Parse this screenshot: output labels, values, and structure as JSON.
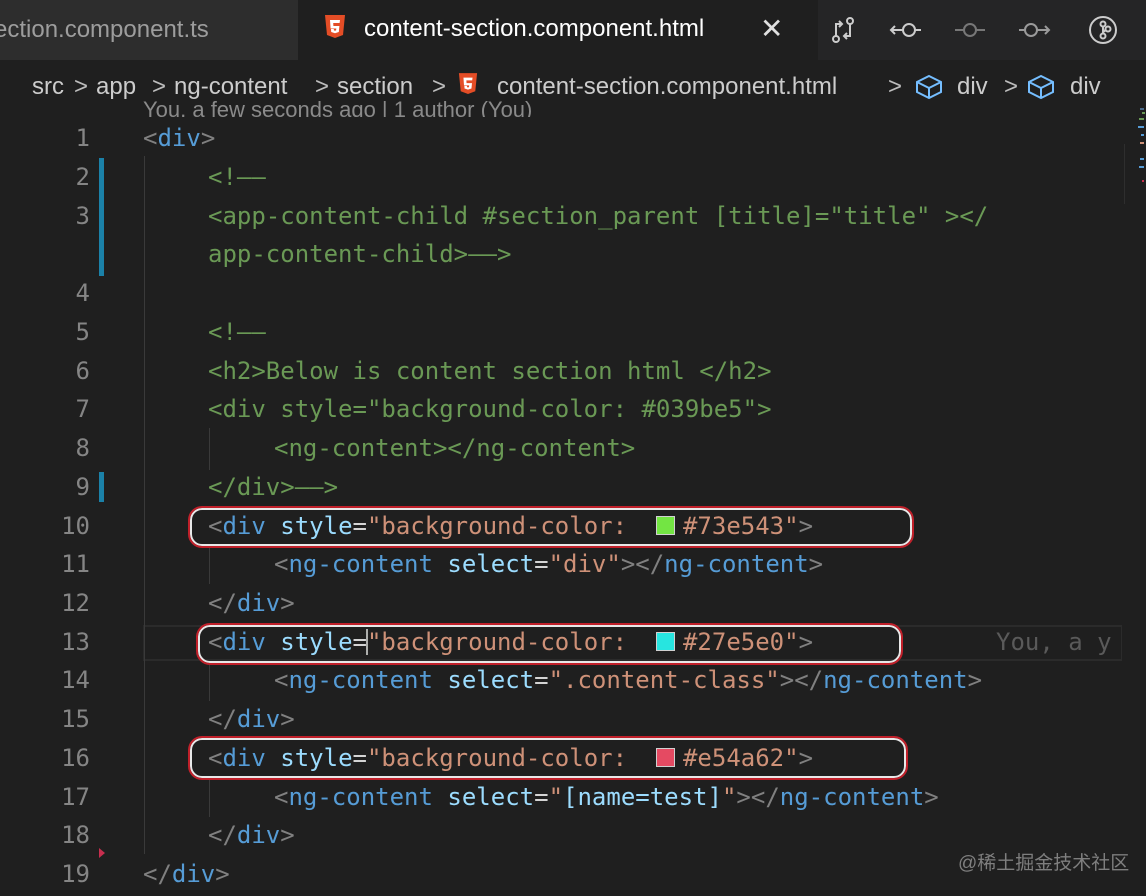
{
  "tabs": [
    {
      "label": "section.component.ts",
      "active": false
    },
    {
      "label": "content-section.component.html",
      "active": true
    }
  ],
  "tab_close_icon": "close-icon",
  "toolbar_icons": [
    "compare-changes-icon",
    "git-previous-icon",
    "git-commit-icon",
    "git-next-icon",
    "source-control-icon"
  ],
  "breadcrumb": [
    "src",
    "app",
    "ng-content",
    "section",
    "content-section.component.html",
    "div",
    "div"
  ],
  "blame_header": "You, a few seconds ago | 1 author (You)",
  "inline_blame": "You, a y",
  "swatch_colors": {
    "green": "#73e543",
    "cyan": "#27e5e0",
    "red": "#e54a62"
  },
  "code": {
    "l1_open": "div",
    "l2": "<!——",
    "l3": "<app-content-child #section_parent [title]=\"title\" ></",
    "l3b": "app-content-child>——>",
    "l5": "<!——",
    "l6": "<h2>Below is content section html </h2>",
    "l7": "<div style=\"background-color: #039be5\">",
    "l8": "<ng-content></ng-content>",
    "l9": "</div>——>",
    "tag_div": "div",
    "attr_style": "style",
    "bg_prefix": "\"background-color: ",
    "color1": "#73e543\"",
    "color2": "#27e5e0\"",
    "color3": "#e54a62\"",
    "ng_content": "ng-content",
    "attr_select": "select",
    "sel_div": "\"div\"",
    "sel_class": "\".content-class\"",
    "sel_q_open": "\"",
    "sel_name_attr": "[name=test]",
    "sel_q_close": "\""
  },
  "line_numbers": [
    "1",
    "2",
    "3",
    "4",
    "5",
    "6",
    "7",
    "8",
    "9",
    "10",
    "11",
    "12",
    "13",
    "14",
    "15",
    "16",
    "17",
    "18",
    "19"
  ],
  "watermark": "@稀土掘金技术社区"
}
